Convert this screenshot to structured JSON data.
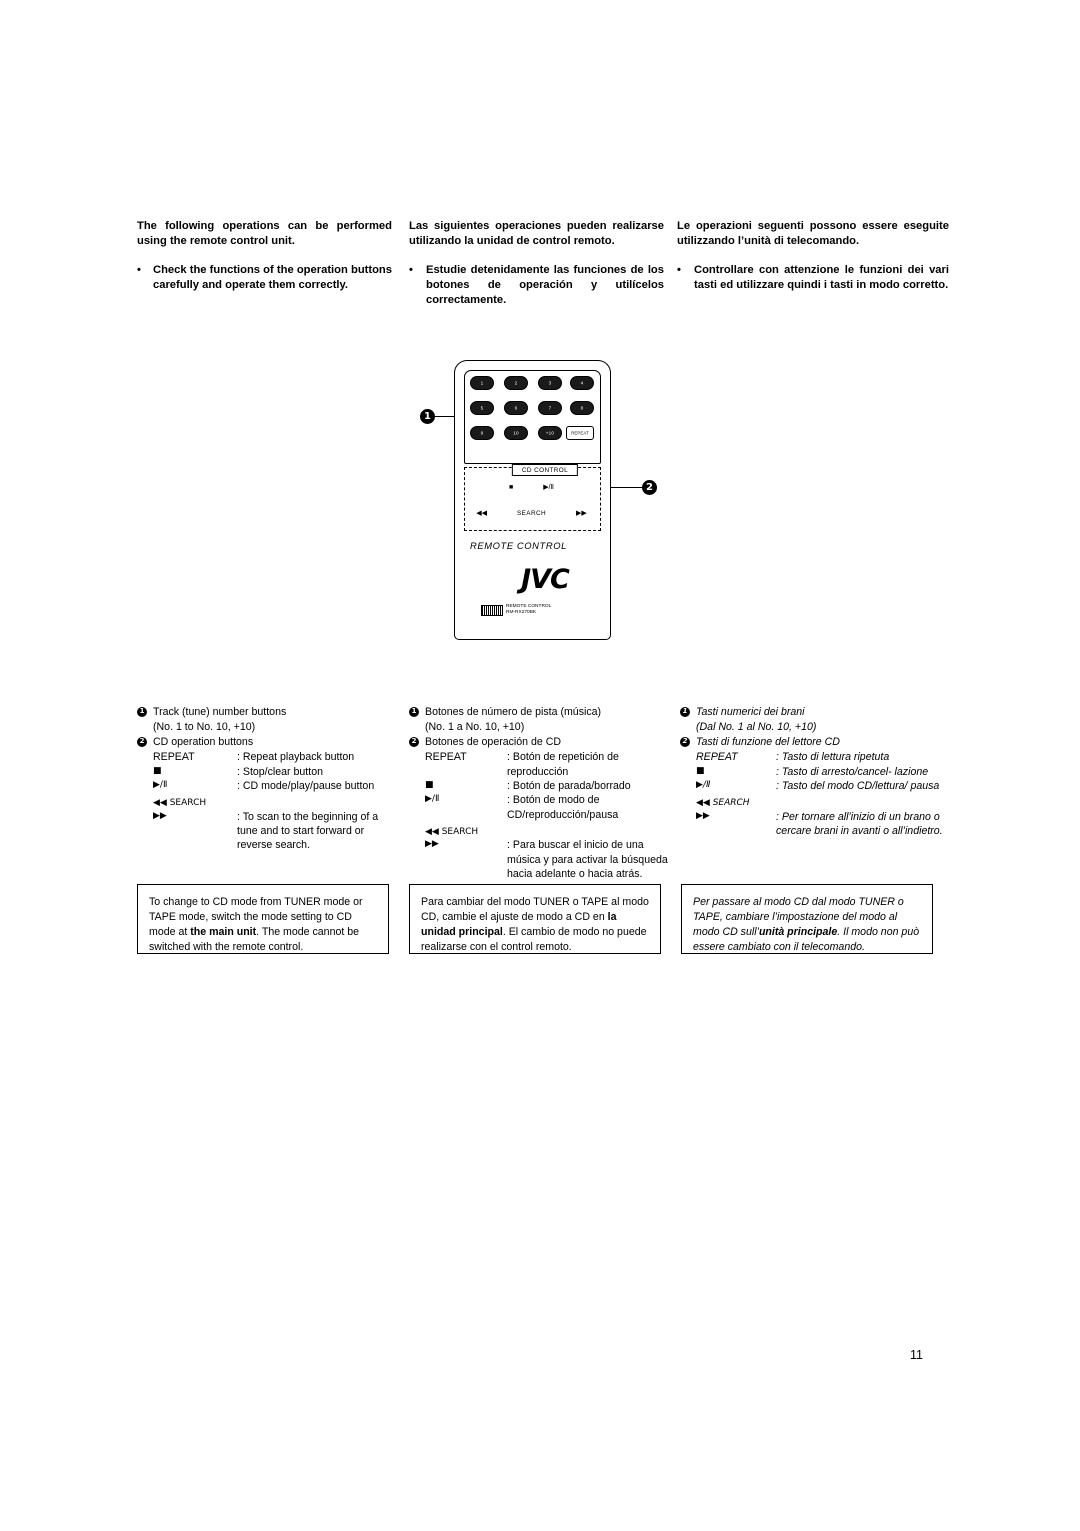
{
  "intro": {
    "english": {
      "heading": "The following operations can be performed using the remote control unit.",
      "bullet_dot": "•",
      "bullet": "Check the functions of the operation buttons carefully and operate them correctly."
    },
    "spanish": {
      "heading": "Las siguientes operaciones pueden realizarse utilizando la unidad de control remoto.",
      "bullet_dot": "•",
      "bullet": "Estudie detenidamente las funciones de los botones de operación y utilícelos correctamente."
    },
    "italian": {
      "heading": "Le operazioni seguenti possono essere eseguite utilizzando l’unità di telecomando.",
      "bullet_dot": "•",
      "bullet": "Controllare con attenzione le funzioni dei vari tasti ed utilizzare quindi i tasti in modo corretto."
    }
  },
  "remote": {
    "callout_1": "1",
    "callout_2": "2",
    "cd_control_label": "CD CONTROL",
    "stop_symbol": "■",
    "play_pause_symbol": "▶/Ⅱ",
    "prev_symbol": "◀◀",
    "next_symbol": "▶▶",
    "search_label": "SEARCH",
    "repeat_label": "REPEAT",
    "remote_control_text": "REMOTE CONTROL",
    "brand": "JVC",
    "model_line1": "REMOTE CONTROL",
    "model_line2": "RM-RX270BK",
    "keys": [
      {
        "label": "1",
        "style": "filled"
      },
      {
        "label": "2",
        "style": "filled"
      },
      {
        "label": "3",
        "style": "filled"
      },
      {
        "label": "4",
        "style": "filled"
      },
      {
        "label": "5",
        "style": "filled"
      },
      {
        "label": "6",
        "style": "filled"
      },
      {
        "label": "7",
        "style": "filled"
      },
      {
        "label": "8",
        "style": "filled"
      },
      {
        "label": "9",
        "style": "filled"
      },
      {
        "label": "10",
        "style": "filled"
      },
      {
        "label": "+10",
        "style": "filled"
      },
      {
        "label": "REPEAT",
        "style": "plain"
      }
    ]
  },
  "legend": {
    "english": {
      "item1_num": "1",
      "item1_line1": "Track (tune) number buttons",
      "item1_line2": "(No. 1 to No. 10, +10)",
      "item2_num": "2",
      "item2_line1": "CD operation buttons",
      "rows": [
        {
          "term": "REPEAT",
          "desc": ": Repeat playback button"
        },
        {
          "term": "■",
          "desc": ": Stop/clear button"
        },
        {
          "term": "▶/Ⅱ",
          "desc": ": CD mode/play/pause button"
        },
        {
          "term": "◀◀ SEARCH",
          "desc": ""
        },
        {
          "term": "▶▶",
          "desc": ": To scan to the beginning of a tune and to start forward or reverse search."
        }
      ]
    },
    "spanish": {
      "item1_num": "1",
      "item1_line1": "Botones de número de pista (música)",
      "item1_line2": "(No. 1 a No. 10, +10)",
      "item2_num": "2",
      "item2_line1": "Botones de operación de CD",
      "rows": [
        {
          "term": "REPEAT",
          "desc": ": Botón de repetición de reproducción"
        },
        {
          "term": "■",
          "desc": ": Botón de parada/borrado"
        },
        {
          "term": "▶/Ⅱ",
          "desc": ": Botón de modo de CD/reproducción/pausa"
        },
        {
          "term": "◀◀ SEARCH",
          "desc": ""
        },
        {
          "term": "▶▶",
          "desc": ": Para buscar el inicio de una música y para activar la búsqueda hacia adelante o hacia atrás."
        }
      ]
    },
    "italian": {
      "item1_num": "1",
      "item1_line1": "Tasti numerici dei brani",
      "item1_line2": "(Dal No. 1 al No. 10, +10)",
      "item2_num": "2",
      "item2_line1": "Tasti di funzione del lettore CD",
      "rows": [
        {
          "term": "REPEAT",
          "desc": ": Tasto di lettura ripetuta"
        },
        {
          "term": "■",
          "desc": ": Tasto di arresto/cancel- lazione"
        },
        {
          "term": "▶/Ⅱ",
          "desc": ": Tasto del modo CD/lettura/ pausa"
        },
        {
          "term": "◀◀ SEARCH",
          "desc": ""
        },
        {
          "term": "▶▶",
          "desc": ": Per tornare all’inizio di un brano o cercare brani in avanti o all’indietro."
        }
      ]
    }
  },
  "notes": {
    "english_pre": "To change to CD mode from TUNER mode or TAPE mode, switch the mode setting to CD mode at ",
    "english_bold": "the main unit",
    "english_post": ". The mode cannot be switched with the remote control.",
    "spanish_pre": "Para cambiar del modo TUNER o TAPE al modo CD, cambie el ajuste de modo a CD en ",
    "spanish_bold": "la unidad principal",
    "spanish_post": ". El cambio de modo no puede realizarse con el control remoto.",
    "italian_pre": "Per passare al modo CD dal modo TUNER o TAPE, cambiare l’impostazione del modo al modo CD sull’",
    "italian_bold": "unità principale",
    "italian_post": ". Il modo non può essere cambiato con il telecomando."
  },
  "page_number": "11"
}
